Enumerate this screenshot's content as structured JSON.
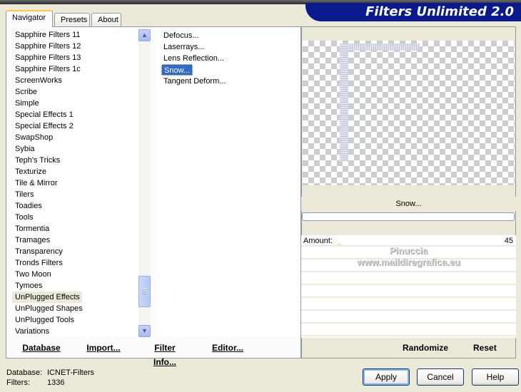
{
  "app": {
    "title": "Filters Unlimited 2.0"
  },
  "tabs": [
    {
      "label": "Navigator",
      "active": true
    },
    {
      "label": "Presets",
      "active": false
    },
    {
      "label": "About",
      "active": false
    }
  ],
  "categories": {
    "items": [
      "Sapphire Filters 11",
      "Sapphire Filters 12",
      "Sapphire Filters 13",
      "Sapphire Filters 1c",
      "ScreenWorks",
      "Scribe",
      "Simple",
      "Special Effects 1",
      "Special Effects 2",
      "SwapShop",
      "Sybia",
      "Teph's Tricks",
      "Texturize",
      "Tile & Mirror",
      "Tilers",
      "Toadies",
      "Tools",
      "Tormentia",
      "Tramages",
      "Transparency",
      "Tronds Filters",
      "Two Moon",
      "Tymoes",
      "UnPlugged Effects",
      "UnPlugged Shapes",
      "UnPlugged Tools",
      "Variations"
    ],
    "selected": "UnPlugged Effects"
  },
  "filters": {
    "items": [
      "Defocus...",
      "Laserrays...",
      "Lens Reflection...",
      "Snow...",
      "Tangent Deform..."
    ],
    "selected": "Snow..."
  },
  "left_buttons": {
    "database": "Database",
    "import": "Import...",
    "filter_info": "Filter Info...",
    "editor": "Editor..."
  },
  "preview": {
    "filter_name": "Snow..."
  },
  "parameters": [
    {
      "label": "Amount:",
      "value": "45"
    }
  ],
  "watermark": {
    "line1": "Pinuccia",
    "line2": "www.maildiregrafica.eu"
  },
  "right_buttons": {
    "randomize": "Randomize",
    "reset": "Reset"
  },
  "status": {
    "database_label": "Database:",
    "database_value": "ICNET-Filters",
    "filters_label": "Filters:",
    "filters_value": "1336"
  },
  "dialog_buttons": {
    "apply": "Apply",
    "cancel": "Cancel",
    "help": "Help"
  },
  "colors": {
    "window_bg": "#ece9d8",
    "title_bg": "#0a1a8c",
    "selection": "#316ac5"
  }
}
